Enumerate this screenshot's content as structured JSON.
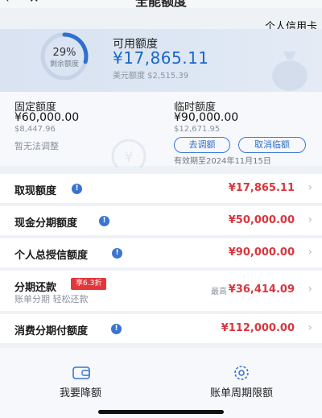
{
  "header": {
    "back_icon": "‹",
    "close_icon": "✕",
    "title": "全能额度",
    "card_type": "个人信用卡"
  },
  "summary": {
    "remaining_pct": "29%",
    "remaining_fraction": 0.29,
    "remaining_label": "剩余额度",
    "available_label": "可用额度",
    "available_value": "¥17,865.11",
    "usd_line": "美元额度 $2,515.39"
  },
  "fixed": {
    "label": "固定额度",
    "value": "¥60,000.00",
    "usd": "$8,447.96",
    "note": "暂无法调整"
  },
  "temporary": {
    "label": "临时额度",
    "value": "¥90,000.00",
    "usd": "$12,671.95",
    "adjust_label": "去调额",
    "cancel_label": "取消临额",
    "expiry": "有效期至2024年11月15日"
  },
  "rows": {
    "cash": {
      "label": "取现额度",
      "value": "¥17,865.11"
    },
    "cash_installment": {
      "label": "现金分期额度",
      "value": "¥50,000.00"
    },
    "total_credit": {
      "label": "个人总授信额度",
      "value": "¥90,000.00"
    },
    "installment": {
      "label": "分期还款",
      "badge": "享6.3折",
      "sub": "账单分期 轻松还款",
      "max_prefix": "最高",
      "value": "¥36,414.09"
    },
    "consumer_installment": {
      "label": "消费分期付额度",
      "value": "¥112,000.00"
    }
  },
  "actions": {
    "reduce_label": "我要降额",
    "cycle_label": "账单周期限额"
  },
  "colors": {
    "accent_blue": "#1a66c9",
    "value_red": "#d9363e",
    "badge_red": "#e2383c"
  }
}
